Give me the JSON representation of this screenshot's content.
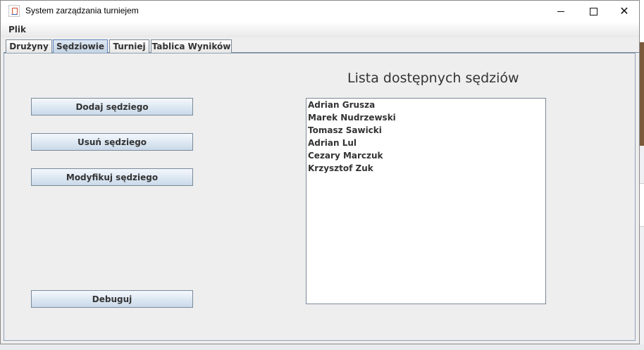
{
  "window": {
    "title": "System zarządzania turniejem",
    "controls": {
      "minimize_icon": "minimize-icon",
      "maximize_icon": "maximize-icon",
      "close_icon": "close-icon",
      "close_glyph": "✕"
    }
  },
  "menu": {
    "items": [
      "Plik"
    ]
  },
  "tabs": [
    {
      "label": "Drużyny",
      "selected": false
    },
    {
      "label": "Sędziowie",
      "selected": true
    },
    {
      "label": "Turniej",
      "selected": false
    },
    {
      "label": "Tablica Wyników",
      "selected": false
    }
  ],
  "actions": {
    "add": "Dodaj sędziego",
    "remove": "Usuń sędziego",
    "modify": "Modyfikuj sędziego",
    "debug": "Debuguj"
  },
  "referees": {
    "title": "Lista dostępnych sędziów",
    "items": [
      "Adrian Grusza",
      "Marek Nudrzewski",
      "Tomasz Sawicki",
      "Adrian Lul",
      "Cezary Marczuk",
      "Krzysztof Zuk"
    ]
  },
  "colors": {
    "selected_tab": "#c3d3e3",
    "button_gradient_bottom": "#c9d9ea",
    "panel_bg": "#eeeeee"
  }
}
